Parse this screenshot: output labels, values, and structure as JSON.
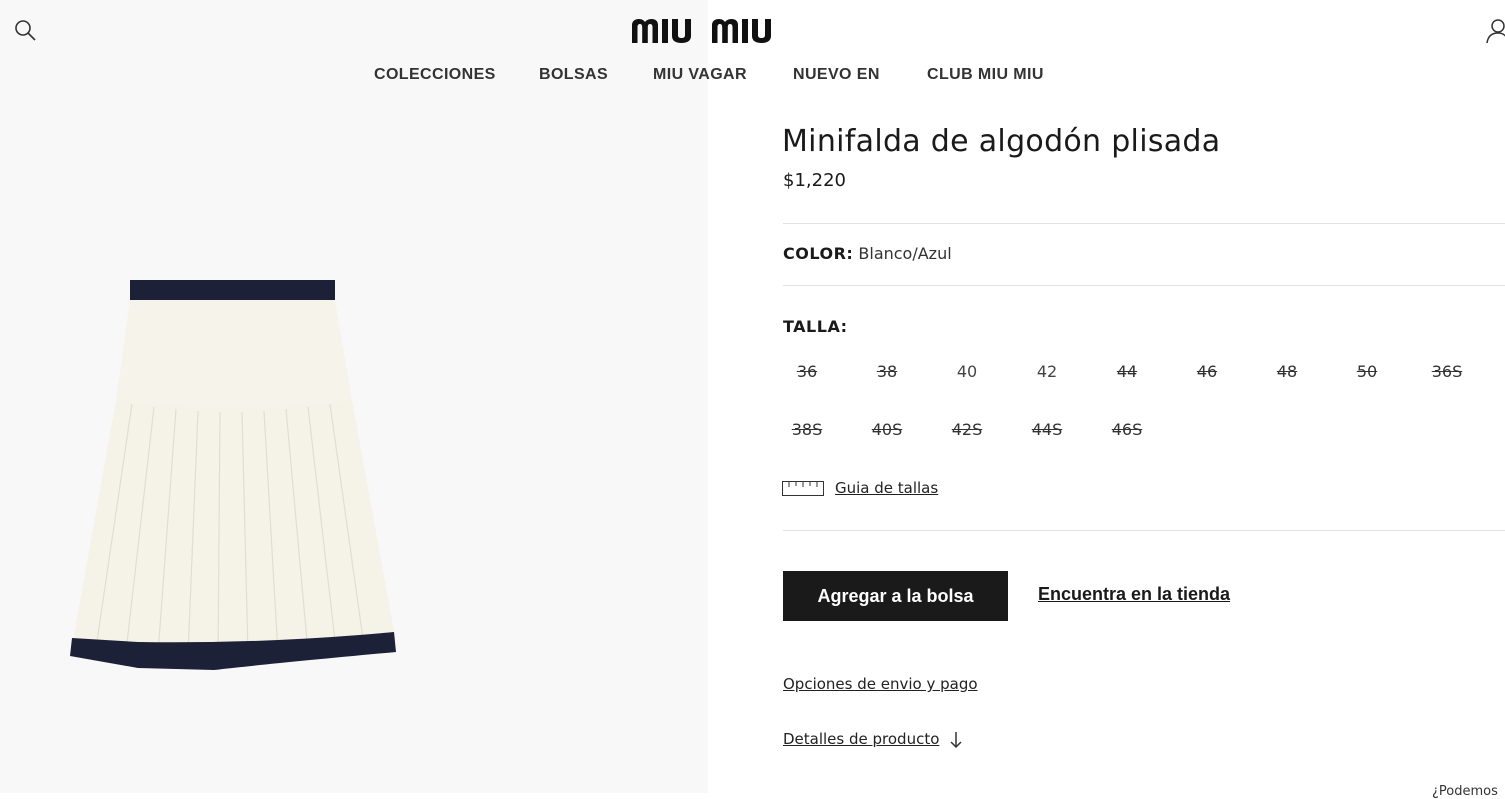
{
  "header": {
    "brand": "miu miu",
    "icons": {
      "search": "search-icon",
      "account": "user-icon"
    }
  },
  "nav": {
    "items": [
      {
        "label": "COLECCIONES"
      },
      {
        "label": "BOLSAS"
      },
      {
        "label": "MIU VAGAR"
      },
      {
        "label": "NUEVO EN"
      },
      {
        "label": "CLUB MIU MIU"
      }
    ]
  },
  "product": {
    "title": "Minifalda de algodón plisada",
    "price": "$1,220",
    "color_label": "COLOR:",
    "color_value": "Blanco/Azul",
    "size_label": "TALLA:",
    "sizes": [
      {
        "label": "36",
        "available": false
      },
      {
        "label": "38",
        "available": false
      },
      {
        "label": "40",
        "available": true
      },
      {
        "label": "42",
        "available": true
      },
      {
        "label": "44",
        "available": false
      },
      {
        "label": "46",
        "available": false
      },
      {
        "label": "48",
        "available": false
      },
      {
        "label": "50",
        "available": false
      },
      {
        "label": "36S",
        "available": false
      },
      {
        "label": "38S",
        "available": false
      },
      {
        "label": "40S",
        "available": false
      },
      {
        "label": "42S",
        "available": false
      },
      {
        "label": "44S",
        "available": false
      },
      {
        "label": "46S",
        "available": false
      }
    ],
    "size_guide": "Guia de tallas",
    "add_to_bag": "Agregar a la bolsa",
    "find_in_store": "Encuentra en la tienda",
    "shipping_link": "Opciones de envio y pago",
    "details_link": "Detalles de producto",
    "footer_cut": "¿Podemos"
  },
  "colors": {
    "skirt": "#f6f3ea",
    "trim": "#1c2137",
    "button_bg": "#1a1a1a",
    "left_bg": "#f8f8f8"
  }
}
